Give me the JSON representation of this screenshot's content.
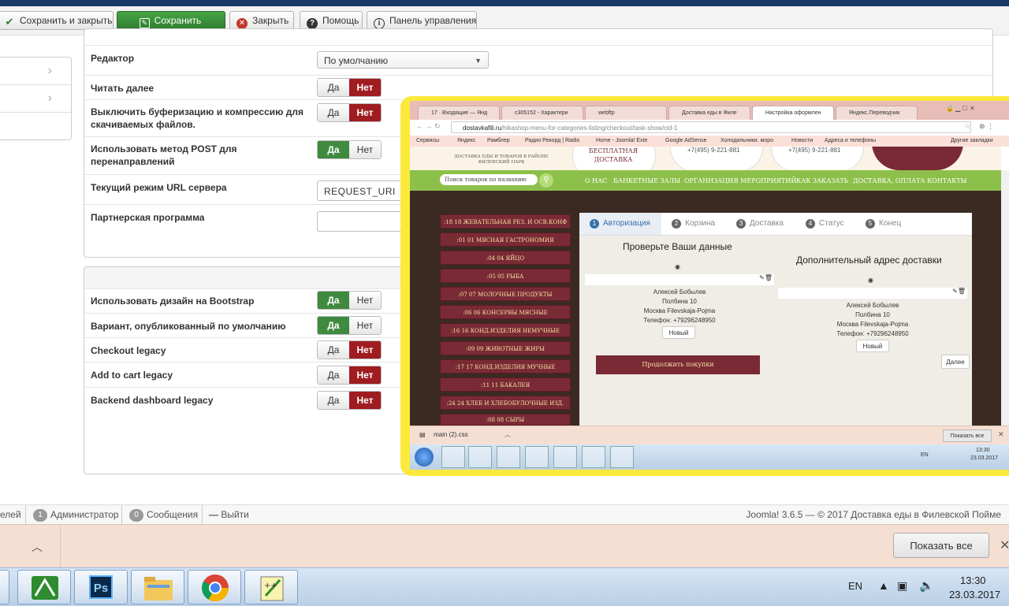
{
  "toolbar": {
    "save_close": "Сохранить и закрыть",
    "save": "Сохранить",
    "close": "Закрыть",
    "help": "Помощь",
    "control_panel": "Панель управления"
  },
  "form": {
    "rows": [
      {
        "label": "Редактор",
        "select": "По умолчанию"
      },
      {
        "label": "Читать далее",
        "yes": "Да",
        "no": "Нет",
        "value": "no"
      },
      {
        "label": "Выключить буферизацию и компрессию для скачиваемых файлов.",
        "yes": "Да",
        "no": "Нет",
        "value": "no"
      },
      {
        "label": "Использовать метод POST для перенаправлений",
        "yes": "Да",
        "no": "Нет",
        "value": "yes"
      },
      {
        "label": "Текущий режим URL сервера",
        "input": "REQUEST_URI"
      },
      {
        "label": "Партнерская программа"
      }
    ],
    "rows2": [
      {
        "label": "Использовать дизайн на Bootstrap",
        "yes": "Да",
        "no": "Нет",
        "value": "yes"
      },
      {
        "label": "Вариант, опубликованный по умолчанию",
        "yes": "Да",
        "no": "Нет",
        "value": "yes"
      },
      {
        "label": "Checkout legacy",
        "yes": "Да",
        "no": "Нет",
        "value": "no"
      },
      {
        "label": "Add to cart legacy",
        "yes": "Да",
        "no": "Нет",
        "value": "no"
      },
      {
        "label": "Backend dashboard legacy",
        "yes": "Да",
        "no": "Нет",
        "value": "no"
      }
    ]
  },
  "statusbar": {
    "left_cut": "елей",
    "admin_count": "1",
    "admin_label": "Администратор",
    "msg_count": "0",
    "msg_label": "Сообщения",
    "logout": "Выйти",
    "right": "Joomla! 3.6.5 — © 2017 Доставка еды в Филевской Пойме"
  },
  "downloads": {
    "show_all": "Показать все"
  },
  "taskbar": {
    "lang": "EN",
    "time": "13:30",
    "date": "23.03.2017"
  },
  "nested": {
    "tabs": [
      "17 · Входящие — Янд",
      "c305152 - Характери",
      "webftp",
      "Доставка еды в Филе",
      "Настройка оформлен",
      "Яндекс.Переводчик"
    ],
    "url_domain": "dostavkafili.ru",
    "url_path": "/hikashop-menu-for-categories-listing/checkout/task-show/cid-1",
    "bookmarks": [
      "Сервисы",
      "Яндекс",
      "Рамблер",
      "Радио Рекорд | Radio",
      "Home - Joomla! Exte",
      "Google AdSense",
      "Холодильники, моро",
      "Новости",
      "Адреса и телефоны"
    ],
    "bookmarks_other": "Другие закладки",
    "site_subtitle": "ДОСТАВКА ЕДЫ И ТОВАРОВ В РАЙОНЕ ФИЛЕВСКИЙ ПАРК",
    "free_delivery": "БЕСПЛАТНАЯ ДОСТАВКА",
    "phone": "+7(495) 9-221-881",
    "search_placeholder": "Поиск товаров по названию",
    "nav": [
      "О НАС",
      "БАНКЕТНЫЕ ЗАЛЫ",
      "ОРГАНИЗАЦИЯ МЕРОПРИЯТИЙ",
      "КАК ЗАКАЗАТЬ",
      "ДОСТАВКА, ОПЛАТА",
      "КОНТАКТЫ"
    ],
    "categories": [
      ":18 18 ЖЕВАТЕЛЬНАЯ РЕЗ. И ОСВ.КОНФ",
      ":01 01 МЯСНАЯ ГАСТРОНОМИЯ",
      ":04 04 ЯЙЦО",
      ":05 05 РЫБА",
      ":07 07 МОЛОЧНЫЕ ПРОДУКТЫ",
      ":06 06 КОНСЕРВЫ МЯСНЫЕ",
      ":16 16 КОНД.ИЗДЕЛИЯ НЕМУЧНЫЕ",
      ":09 09 ЖИВОТНЫЕ ЖИРЫ",
      ":17 17 КОНД.ИЗДЕЛИЯ МУЧНЫЕ",
      ":11 11 БАКАЛЕЯ",
      ":24 24 ХЛЕБ И ХЛЕБОБУЛОЧНЫЕ ИЗД.",
      ":08 08 СЫРЫ"
    ],
    "steps": [
      {
        "n": "1",
        "label": "Авторизация"
      },
      {
        "n": "2",
        "label": "Корзина"
      },
      {
        "n": "3",
        "label": "Доставка"
      },
      {
        "n": "4",
        "label": "Статус"
      },
      {
        "n": "5",
        "label": "Конец"
      }
    ],
    "check_data": "Проверьте Ваши данные",
    "extra_address": "Дополнительный адрес доставки",
    "addr_name": "Алексей Бобылев",
    "addr_street": "Полбина 10",
    "addr_city": "Москва Filevskaja-Pojma",
    "addr_phone": "Телефон: +79296248950",
    "new_btn": "Новый",
    "continue_btn": "Продолжить покупки",
    "next_btn": "Далее",
    "download_file": "main (2).css",
    "show_all": "Показать все",
    "lang": "EN",
    "time": "13:30",
    "date": "23.03.2017"
  }
}
